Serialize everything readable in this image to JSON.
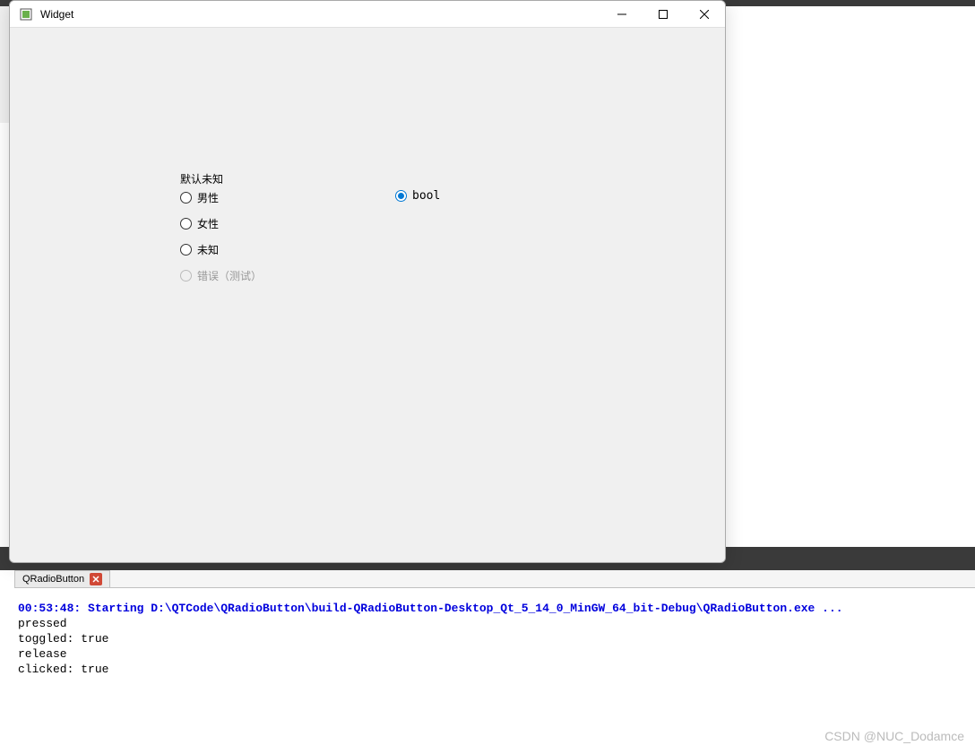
{
  "window": {
    "title": "Widget"
  },
  "form": {
    "group_label": "默认未知",
    "radios": {
      "male": "男性",
      "female": "女性",
      "unknown": "未知",
      "error": "错误（测试）"
    },
    "bool_label": "bool"
  },
  "tab": {
    "label": "QRadioButton"
  },
  "output": {
    "line1": "00:53:48: Starting D:\\QTCode\\QRadioButton\\build-QRadioButton-Desktop_Qt_5_14_0_MinGW_64_bit-Debug\\QRadioButton.exe ...",
    "line2": "pressed",
    "line3": "toggled: true",
    "line4": "release",
    "line5": "clicked: true"
  },
  "watermark": "CSDN @NUC_Dodamce"
}
